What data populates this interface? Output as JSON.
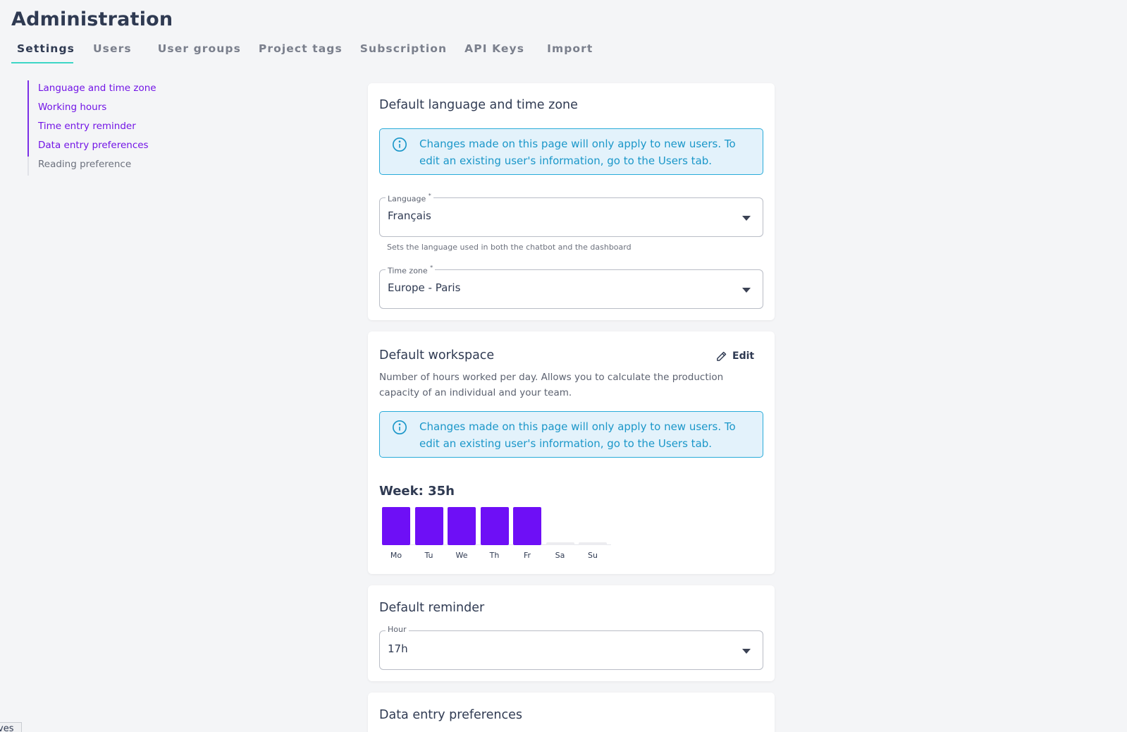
{
  "header": {
    "title": "Administration"
  },
  "tabs": [
    {
      "label": "Settings"
    },
    {
      "label": "Users"
    },
    {
      "label": "User groups"
    },
    {
      "label": "Project tags"
    },
    {
      "label": "Subscription"
    },
    {
      "label": "API Keys"
    },
    {
      "label": "Import"
    }
  ],
  "sidebar": {
    "items": [
      {
        "label": "Language and time zone"
      },
      {
        "label": "Working hours"
      },
      {
        "label": "Time entry reminder"
      },
      {
        "label": "Data entry preferences"
      },
      {
        "label": "Reading preference"
      }
    ]
  },
  "language_card": {
    "title": "Default language and time zone",
    "alert": "Changes made on this page will only apply to new users. To edit an existing user's information, go to the Users tab.",
    "language": {
      "label": "Language",
      "required_mark": "*",
      "value": "Français",
      "helper": "Sets the language used in both the chatbot and the dashboard"
    },
    "timezone": {
      "label": "Time zone",
      "required_mark": "*",
      "value": "Europe - Paris"
    }
  },
  "workspace_card": {
    "title": "Default workspace",
    "edit_label": "Edit",
    "description": "Number of hours worked per day. Allows you to calculate the production capacity of an individual and your team.",
    "alert": "Changes made on this page will only apply to new users. To edit an existing user's information, go to the Users tab.",
    "week_title": "Week: 35h"
  },
  "reminder_card": {
    "title": "Default reminder",
    "hour": {
      "label": "Hour",
      "value": "17h"
    }
  },
  "data_entry_card": {
    "title": "Data entry preferences"
  },
  "corner_tab": {
    "label": "ves"
  },
  "colors": {
    "accent": "#6e0ff6",
    "tab_underline": "#3dd6c6",
    "info": "#1b97c9"
  },
  "chart_data": {
    "type": "bar",
    "categories": [
      "Mo",
      "Tu",
      "We",
      "Th",
      "Fr",
      "Sa",
      "Su"
    ],
    "values": [
      7,
      7,
      7,
      7,
      7,
      0,
      0
    ],
    "ylim": [
      0,
      7
    ]
  }
}
